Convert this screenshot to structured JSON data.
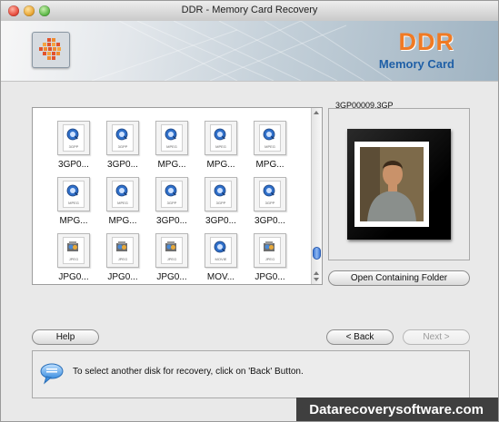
{
  "window": {
    "title": "DDR - Memory Card Recovery"
  },
  "banner": {
    "brand": "DDR",
    "subtitle": "Memory Card"
  },
  "files": [
    {
      "name": "3GP0...",
      "type": "3GPP",
      "icon": "quicktime-icon"
    },
    {
      "name": "3GP0...",
      "type": "3GPP",
      "icon": "quicktime-icon"
    },
    {
      "name": "MPG...",
      "type": "MPEG",
      "icon": "quicktime-icon"
    },
    {
      "name": "MPG...",
      "type": "MPEG",
      "icon": "quicktime-icon"
    },
    {
      "name": "MPG...",
      "type": "MPEG",
      "icon": "quicktime-icon"
    },
    {
      "name": "MPG...",
      "type": "MPEG",
      "icon": "quicktime-icon"
    },
    {
      "name": "MPG...",
      "type": "MPEG",
      "icon": "quicktime-icon"
    },
    {
      "name": "3GP0...",
      "type": "3GPP",
      "icon": "quicktime-icon"
    },
    {
      "name": "3GP0...",
      "type": "3GPP",
      "icon": "quicktime-icon"
    },
    {
      "name": "3GP0...",
      "type": "3GPP",
      "icon": "quicktime-icon"
    },
    {
      "name": "JPG0...",
      "type": "JPEG",
      "icon": "preview-icon"
    },
    {
      "name": "JPG0...",
      "type": "JPEG",
      "icon": "preview-icon"
    },
    {
      "name": "JPG0...",
      "type": "JPEG",
      "icon": "preview-icon"
    },
    {
      "name": "MOV...",
      "type": "MOVIE",
      "icon": "quicktime-icon"
    },
    {
      "name": "JPG0...",
      "type": "JPEG",
      "icon": "preview-icon"
    }
  ],
  "preview": {
    "label": "3GP00009.3GP",
    "open_folder": "Open Containing Folder"
  },
  "buttons": {
    "help": "Help",
    "back": "< Back",
    "next": "Next >"
  },
  "status": {
    "message": "To select another disk for recovery, click on 'Back' Button."
  },
  "footer": {
    "website": "Datarecoverysoftware.com"
  }
}
